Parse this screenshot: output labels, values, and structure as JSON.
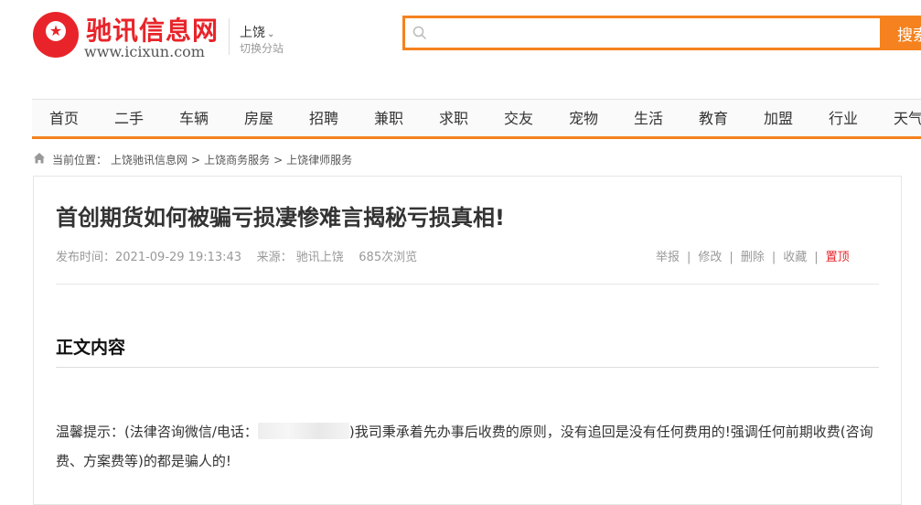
{
  "header": {
    "site_name": "驰讯信息网",
    "domain": "www.icixun.com",
    "city": "上饶",
    "switch_label": "切换分站",
    "search": {
      "placeholder": "",
      "button": "搜索"
    }
  },
  "nav": [
    "首页",
    "二手",
    "车辆",
    "房屋",
    "招聘",
    "兼职",
    "求职",
    "交友",
    "宠物",
    "生活",
    "教育",
    "加盟",
    "行业",
    "天气"
  ],
  "breadcrumb": {
    "prefix": "当前位置：",
    "items": [
      "上饶驰讯信息网",
      "上饶商务服务",
      "上饶律师服务"
    ],
    "separator": ">"
  },
  "article": {
    "title": "首创期货如何被骗亏损凄惨难言揭秘亏损真相!",
    "publish_time": "发布时间：2021-09-29 19:13:43",
    "source": "来源：  驰讯上饶",
    "views": "685次浏览",
    "actions": [
      "举报",
      "修改",
      "删除",
      "收藏",
      "置顶"
    ],
    "section_title": "正文内容",
    "para_lead": "温馨提示：(法律咨询微信/电话：",
    "para_rest": ")我司秉承着先办事后收费的原则，没有追回是没有任何费用的!强调任何前期收费(咨询费、方案费等)的都是骗人的!"
  },
  "colors": {
    "brand_red": "#e8242a",
    "accent_orange": "#f5821f"
  }
}
